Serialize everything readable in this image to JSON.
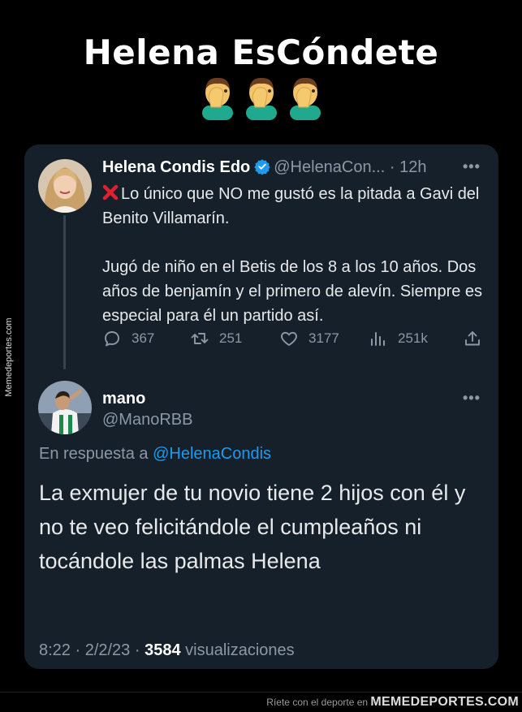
{
  "meme": {
    "title": "Helena EsCóndete",
    "emoji_icons": [
      "man-facepalming-icon",
      "man-facepalming-icon",
      "man-facepalming-icon"
    ]
  },
  "tweet": {
    "author_name": "Helena Condis Edo",
    "handle": "@HelenaCon...",
    "time": "· 12h",
    "more": "•••",
    "line1": "Lo único que NO me gustó es la pitada a Gavi del Benito Villamarín.",
    "line1_icon": "cross-mark-icon",
    "line2": "Jugó de niño en el Betis de los 8 a los 10 años. Dos años de benjamín y el primero de alevín. Siempre es especial para él un partido así.",
    "stats": {
      "replies": "367",
      "retweets": "251",
      "likes": "3177",
      "views": "251k"
    }
  },
  "reply": {
    "author_name": "mano",
    "handle": "@ManoRBB",
    "more": "•••",
    "in_reply_prefix": "En respuesta a",
    "in_reply_mention": "@HelenaCondis",
    "text": "La exmujer de tu novio tiene 2 hijos con él y no te veo felicitándole el cumpleaños ni tocándole las palmas Helena",
    "time": "8:22 · 2/2/23 ·",
    "view_count": "3584",
    "view_label": "visualizaciones"
  },
  "watermarks": {
    "side": "Memedeportes.com",
    "footer_prefix": "Ríete con el deporte en",
    "footer_brand": "MEMEDEPORTES.COM"
  },
  "colors": {
    "background": "#000000",
    "card": "#15202b",
    "text": "#e7e9ea",
    "muted": "#8b98a5",
    "accent": "#1d9bf0"
  }
}
